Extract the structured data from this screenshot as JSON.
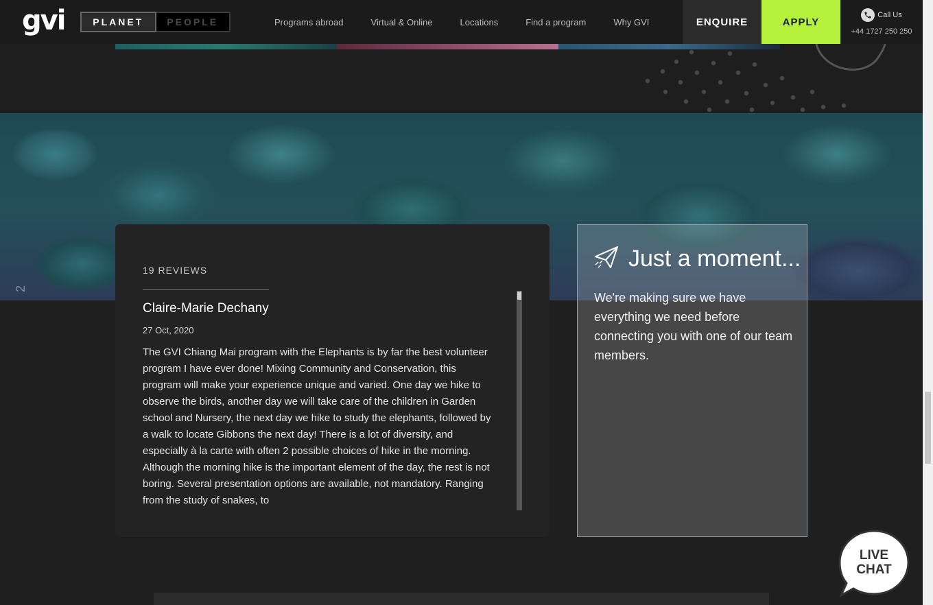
{
  "nav": {
    "logo": "gvi",
    "toggle": {
      "active": "PLANET",
      "inactive": "PEOPLE"
    },
    "links": [
      "Programs abroad",
      "Virtual & Online",
      "Locations",
      "Find a program",
      "Why GVI"
    ],
    "enquire": "ENQUIRE",
    "apply": "APPLY",
    "call_label": "Call Us",
    "phone": "+44 1727 250 250"
  },
  "reef": {
    "side_number": "2"
  },
  "reviews": {
    "count": "19 REVIEWS",
    "items": [
      {
        "name": "Claire-Marie Dechany",
        "date": "27 Oct, 2020",
        "text": "The GVI Chiang Mai program with the Elephants is by far the best volunteer program I have ever done! Mixing Community and Conservation, this program will make your experience unique and varied. One day we hike to observe the birds, another day we will take care of the children in Garden school and Nursery, the next day we hike to study the elephants, followed by a walk to locate Gibbons the next day! There is a lot of diversity, and especially à la carte with often 2 possible choices of hike in the morning. Although the morning hike is the important element of the day, the rest is not boring. Several presentation options are available, not mandatory. Ranging from the study of snakes, to"
      }
    ]
  },
  "moment": {
    "title": "Just a moment...",
    "text": "We're making sure we have everything we need before connecting you with one of our team members."
  },
  "live_chat": {
    "line1": "LIVE",
    "line2": "CHAT"
  },
  "colors": {
    "apply_green": "#b6f23b",
    "background": "#1e1e1e",
    "card": "#232323"
  },
  "icons": [
    "phone-icon",
    "paper-plane-icon",
    "live-chat-bubble-icon"
  ]
}
